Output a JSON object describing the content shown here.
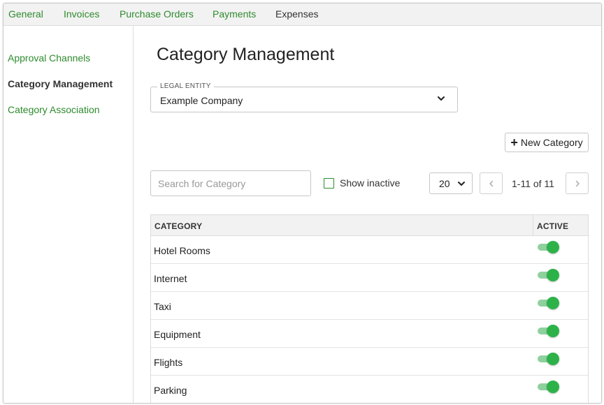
{
  "topnav": {
    "tabs": [
      {
        "label": "General"
      },
      {
        "label": "Invoices"
      },
      {
        "label": "Purchase Orders"
      },
      {
        "label": "Payments"
      },
      {
        "label": "Expenses"
      }
    ],
    "active": "Expenses"
  },
  "sidebar": {
    "items": [
      {
        "label": "Approval Channels"
      },
      {
        "label": "Category Management"
      },
      {
        "label": "Category Association"
      }
    ],
    "active": "Category Management"
  },
  "main": {
    "title": "Category Management",
    "legal_entity": {
      "legend": "LEGAL ENTITY",
      "value": "Example Company"
    },
    "new_button": "New Category",
    "search": {
      "placeholder": "Search for Category",
      "value": ""
    },
    "show_inactive": {
      "label": "Show inactive",
      "checked": false
    },
    "page_size": "20",
    "pagination": "1-11 of 11"
  },
  "table": {
    "headers": {
      "category": "CATEGORY",
      "active": "ACTIVE"
    },
    "rows": [
      {
        "category": "Hotel Rooms",
        "active": true
      },
      {
        "category": "Internet",
        "active": true
      },
      {
        "category": "Taxi",
        "active": true
      },
      {
        "category": "Equipment",
        "active": true
      },
      {
        "category": "Flights",
        "active": true
      },
      {
        "category": "Parking",
        "active": true
      }
    ]
  },
  "colors": {
    "link_green": "#2e8b2e",
    "toggle_on": "#2db24a",
    "toggle_track": "#8fd19e"
  }
}
